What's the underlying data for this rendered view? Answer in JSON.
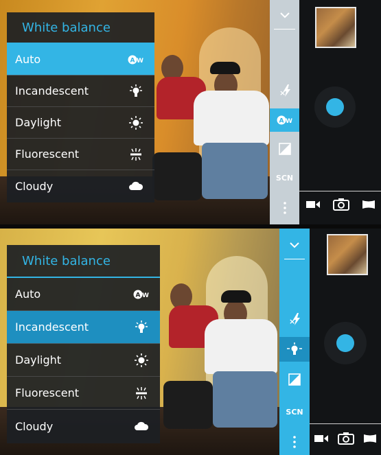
{
  "menu": {
    "title": "White balance",
    "items": [
      {
        "label": "Auto",
        "icon": "auto-wb-icon"
      },
      {
        "label": "Incandescent",
        "icon": "incandescent-icon"
      },
      {
        "label": "Daylight",
        "icon": "daylight-icon"
      },
      {
        "label": "Fluorescent",
        "icon": "fluorescent-icon"
      },
      {
        "label": "Cloudy",
        "icon": "cloudy-icon"
      }
    ]
  },
  "screens": [
    {
      "selected": "Auto"
    },
    {
      "selected": "Incandescent"
    }
  ],
  "strip": {
    "flash_icon": "flash-auto-icon",
    "exposure_icon": "exposure-icon",
    "scene_label": "SCN",
    "more_icon": "more-icon",
    "collapse_icon": "chevron-down-icon"
  },
  "modes": [
    "video-icon",
    "camera-icon",
    "panorama-icon"
  ],
  "icon_badges": {
    "auto": "A",
    "auto_sub": "W"
  },
  "colors": {
    "accent": "#33b5e5",
    "panel": "#121416"
  }
}
